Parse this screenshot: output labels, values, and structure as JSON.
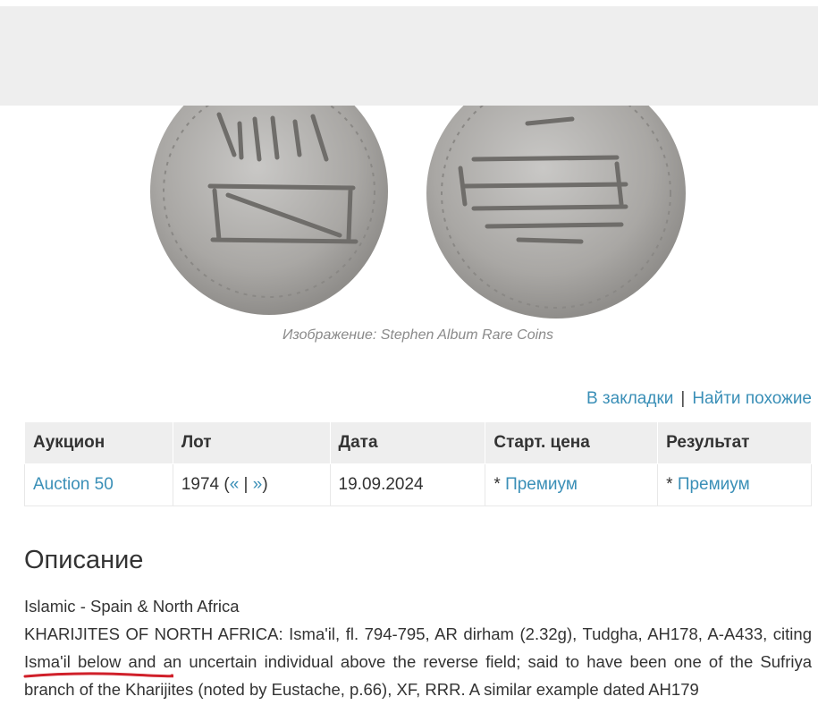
{
  "image_caption": "Изображение: Stephen Album Rare Coins",
  "actions": {
    "bookmark": "В закладки",
    "separator": "|",
    "find_similar": "Найти похожие"
  },
  "table": {
    "headers": [
      "Аукцион",
      "Лот",
      "Дата",
      "Старт. цена",
      "Результат"
    ],
    "row": {
      "auction": "Auction 50",
      "lot_number": "1974 (",
      "lot_prev": "«",
      "lot_sep": " | ",
      "lot_next": "»",
      "lot_close": ")",
      "date": "19.09.2024",
      "start_price_prefix": "* ",
      "start_price": "Премиум",
      "result_prefix": "* ",
      "result": "Премиум"
    }
  },
  "description": {
    "title": "Описание",
    "line1": "Islamic - Spain & North Africa",
    "text": "KHARIJITES OF NORTH AFRICA: Isma'il, fl. 794-795, AR dirham (2.32g), Tudgha, AH178, A-A433, citing Isma'il below and an uncertain individual above the reverse field; said to have been one of the Sufriya branch of the Kharijites (noted by Eustache, p.66), XF, RRR. A similar example dated AH179"
  },
  "colors": {
    "link": "#3a8fb7",
    "header_bg": "#eeeeee",
    "topbar_bg": "#eeeeee",
    "annotation": "#d0202a"
  }
}
